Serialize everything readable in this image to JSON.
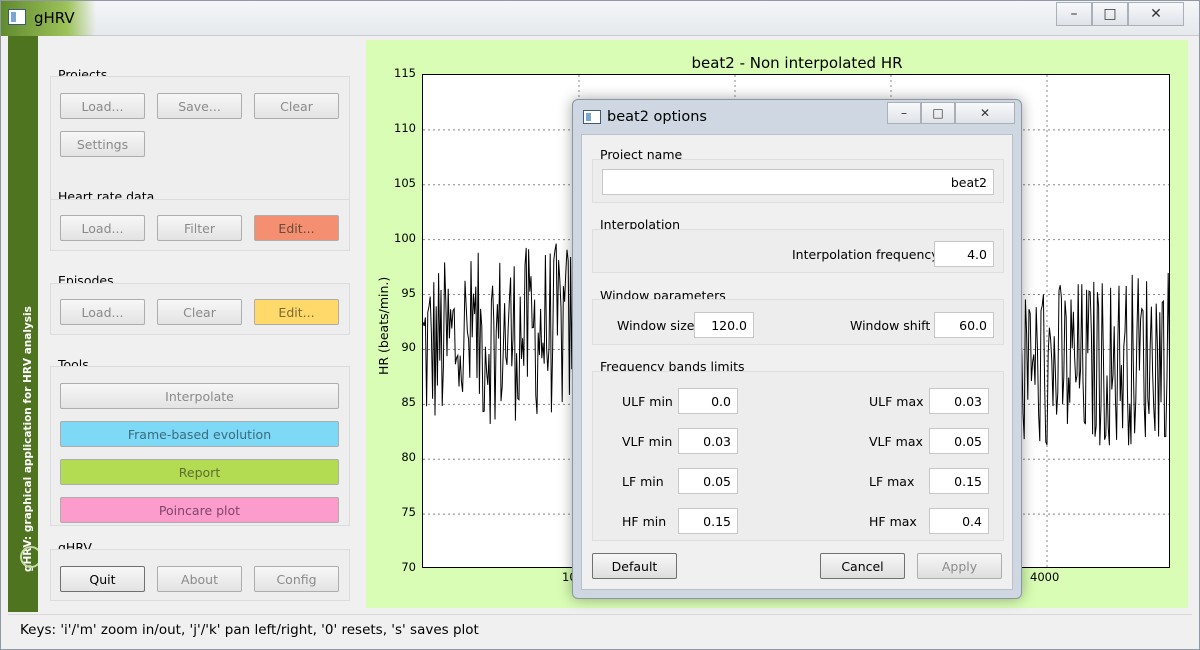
{
  "window": {
    "title": "gHRV"
  },
  "sidebar": {
    "vertical_text": "gHRV: graphical application for HRV analysis"
  },
  "panel": {
    "projects": {
      "label": "Projects",
      "load": "Load...",
      "save": "Save...",
      "clear": "Clear",
      "settings": "Settings"
    },
    "heart_rate": {
      "label": "Heart rate data",
      "load": "Load...",
      "filter": "Filter",
      "edit": "Edit..."
    },
    "episodes": {
      "label": "Episodes",
      "load": "Load...",
      "clear": "Clear",
      "edit": "Edit..."
    },
    "tools": {
      "label": "Tools",
      "interpolate": "Interpolate",
      "frame_based": "Frame-based evolution",
      "report": "Report",
      "poincare": "Poincare plot"
    },
    "ghrv": {
      "label": "gHRV",
      "quit": "Quit",
      "about": "About",
      "config": "Config"
    }
  },
  "chart_data": {
    "type": "line",
    "title": "beat2 - Non interpolated HR",
    "ylabel": "HR (beats/min.)",
    "xlabel": "",
    "ylim": [
      70,
      115
    ],
    "yticks": [
      "115",
      "110",
      "105",
      "100",
      "95",
      "90",
      "85",
      "80",
      "75",
      "70"
    ],
    "xticks_visible": [
      "10",
      "4000"
    ],
    "grid": true,
    "series": [
      {
        "values_description_range": [
          73,
          114
        ]
      }
    ]
  },
  "dialog": {
    "title": "beat2 options",
    "project": {
      "label": "Project name",
      "value": "beat2"
    },
    "interpolation": {
      "label": "Interpolation",
      "freq_label": "Interpolation frequency",
      "freq_value": "4.0"
    },
    "window_params": {
      "label": "Window parameters",
      "size_label": "Window size",
      "size_value": "120.0",
      "shift_label": "Window shift",
      "shift_value": "60.0"
    },
    "bands": {
      "label": "Frequency bands limits",
      "ulf_min_label": "ULF min",
      "ulf_min": "0.0",
      "ulf_max_label": "ULF max",
      "ulf_max": "0.03",
      "vlf_min_label": "VLF min",
      "vlf_min": "0.03",
      "vlf_max_label": "VLF max",
      "vlf_max": "0.05",
      "lf_min_label": "LF min",
      "lf_min": "0.05",
      "lf_max_label": "LF max",
      "lf_max": "0.15",
      "hf_min_label": "HF min",
      "hf_min": "0.15",
      "hf_max_label": "HF max",
      "hf_max": "0.4"
    },
    "buttons": {
      "default": "Default",
      "cancel": "Cancel",
      "apply": "Apply"
    }
  },
  "statusbar": {
    "text": "Keys: 'i'/'m' zoom in/out, 'j'/'k' pan left/right, '0' resets, 's' saves plot"
  },
  "colors": {
    "accent_green": "#4f7420",
    "plot_bg": "#d9fdb4",
    "salmon": "#f48f71",
    "yellow": "#ffd96a",
    "cyan": "#7dd9f5",
    "lime": "#b4dc52",
    "pink": "#fb9ccc"
  }
}
